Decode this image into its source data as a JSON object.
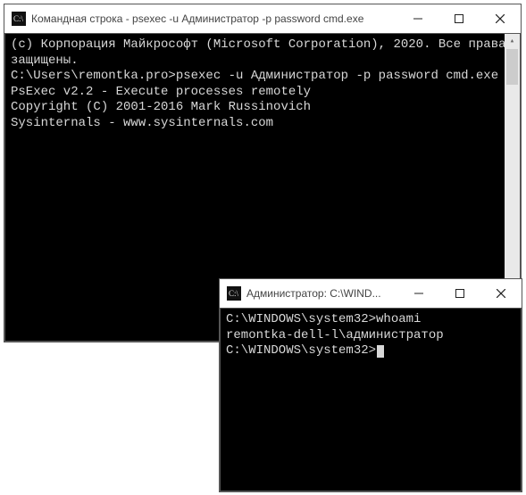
{
  "window1": {
    "title": "Командная строка - psexec  -u Администратор -p password cmd.exe",
    "lines": [
      "(c) Корпорация Майкрософт (Microsoft Corporation), 2020. Все права защищены.",
      "",
      "C:\\Users\\remontka.pro>psexec -u Администратор -p password cmd.exe",
      "",
      "PsExec v2.2 - Execute processes remotely",
      "Copyright (C) 2001-2016 Mark Russinovich",
      "Sysinternals - www.sysinternals.com",
      ""
    ]
  },
  "window2": {
    "title": "Администратор: C:\\WIND...",
    "lines": [
      "",
      "C:\\WINDOWS\\system32>whoami",
      "remontka-dell-l\\администратор",
      "",
      "C:\\WINDOWS\\system32>"
    ]
  },
  "icons": {
    "app": "cmd-icon",
    "minimize": "minimize-icon",
    "maximize": "maximize-icon",
    "close": "close-icon",
    "scroll_up": "chevron-up-icon",
    "scroll_down": "chevron-down-icon"
  }
}
